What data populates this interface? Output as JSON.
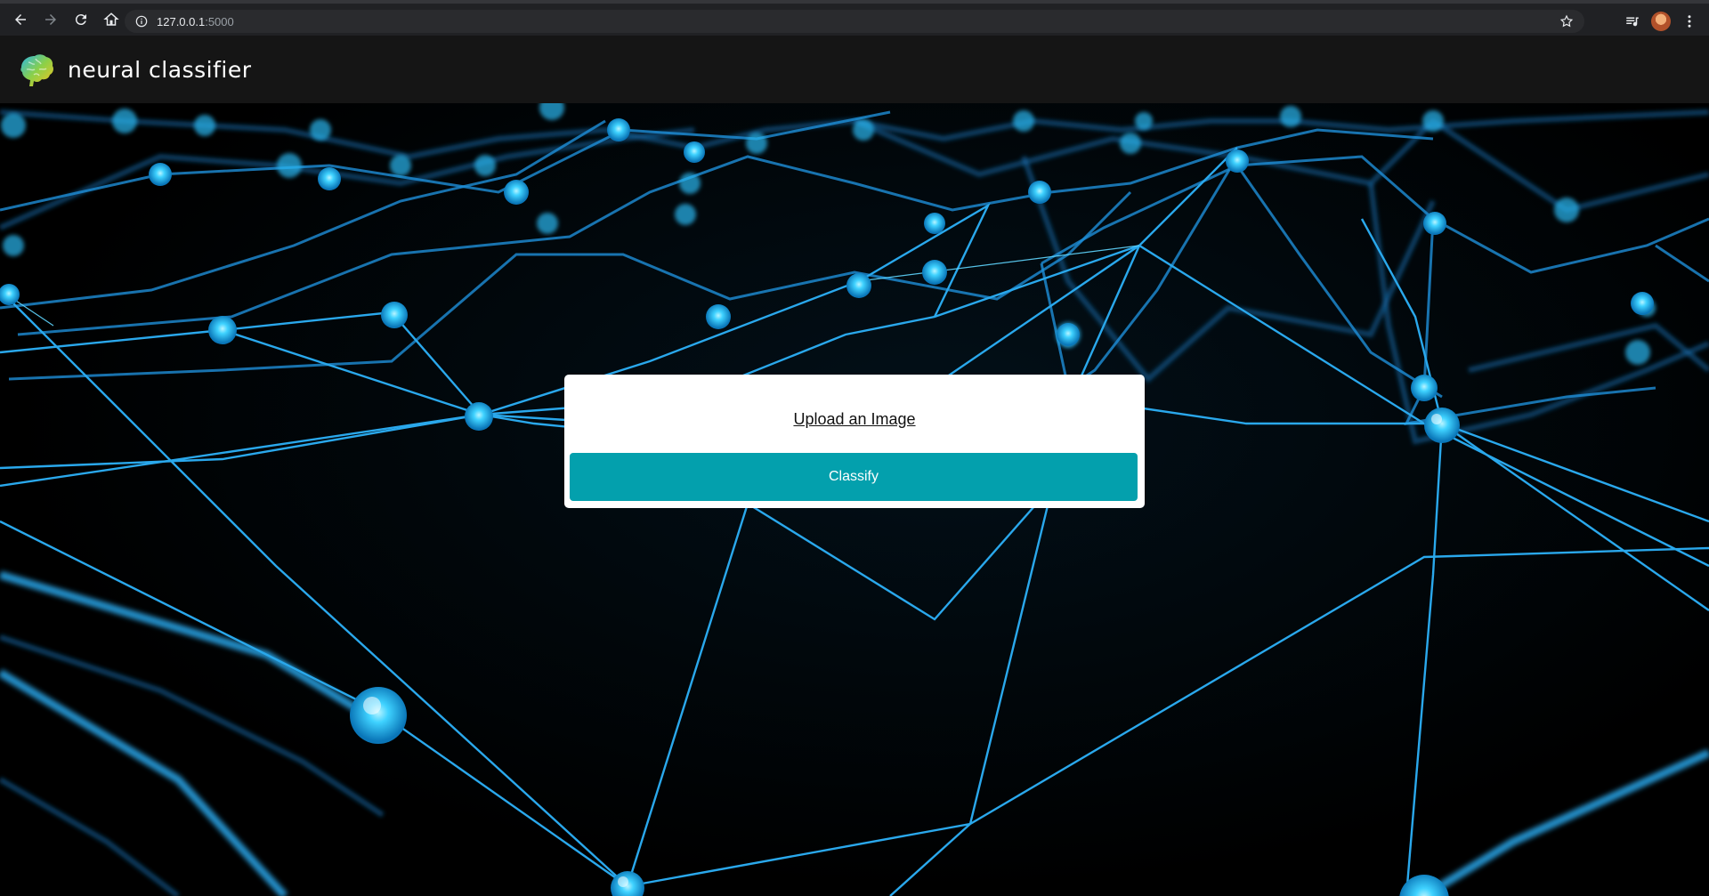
{
  "browser": {
    "url_host": "127.0.0.1",
    "url_port": ":5000",
    "icons": {
      "back": "back-arrow-icon",
      "forward": "forward-arrow-icon",
      "reload": "reload-icon",
      "home": "home-icon",
      "info": "info-icon",
      "bookmark": "star-icon",
      "media": "media-queue-icon",
      "profile": "avatar",
      "menu": "kebab-menu-icon"
    }
  },
  "header": {
    "title": "neural classifier",
    "logo": "brain-icon"
  },
  "card": {
    "upload_label": "Upload an Image",
    "classify_label": "Classify",
    "accent": "#03a0ad"
  }
}
